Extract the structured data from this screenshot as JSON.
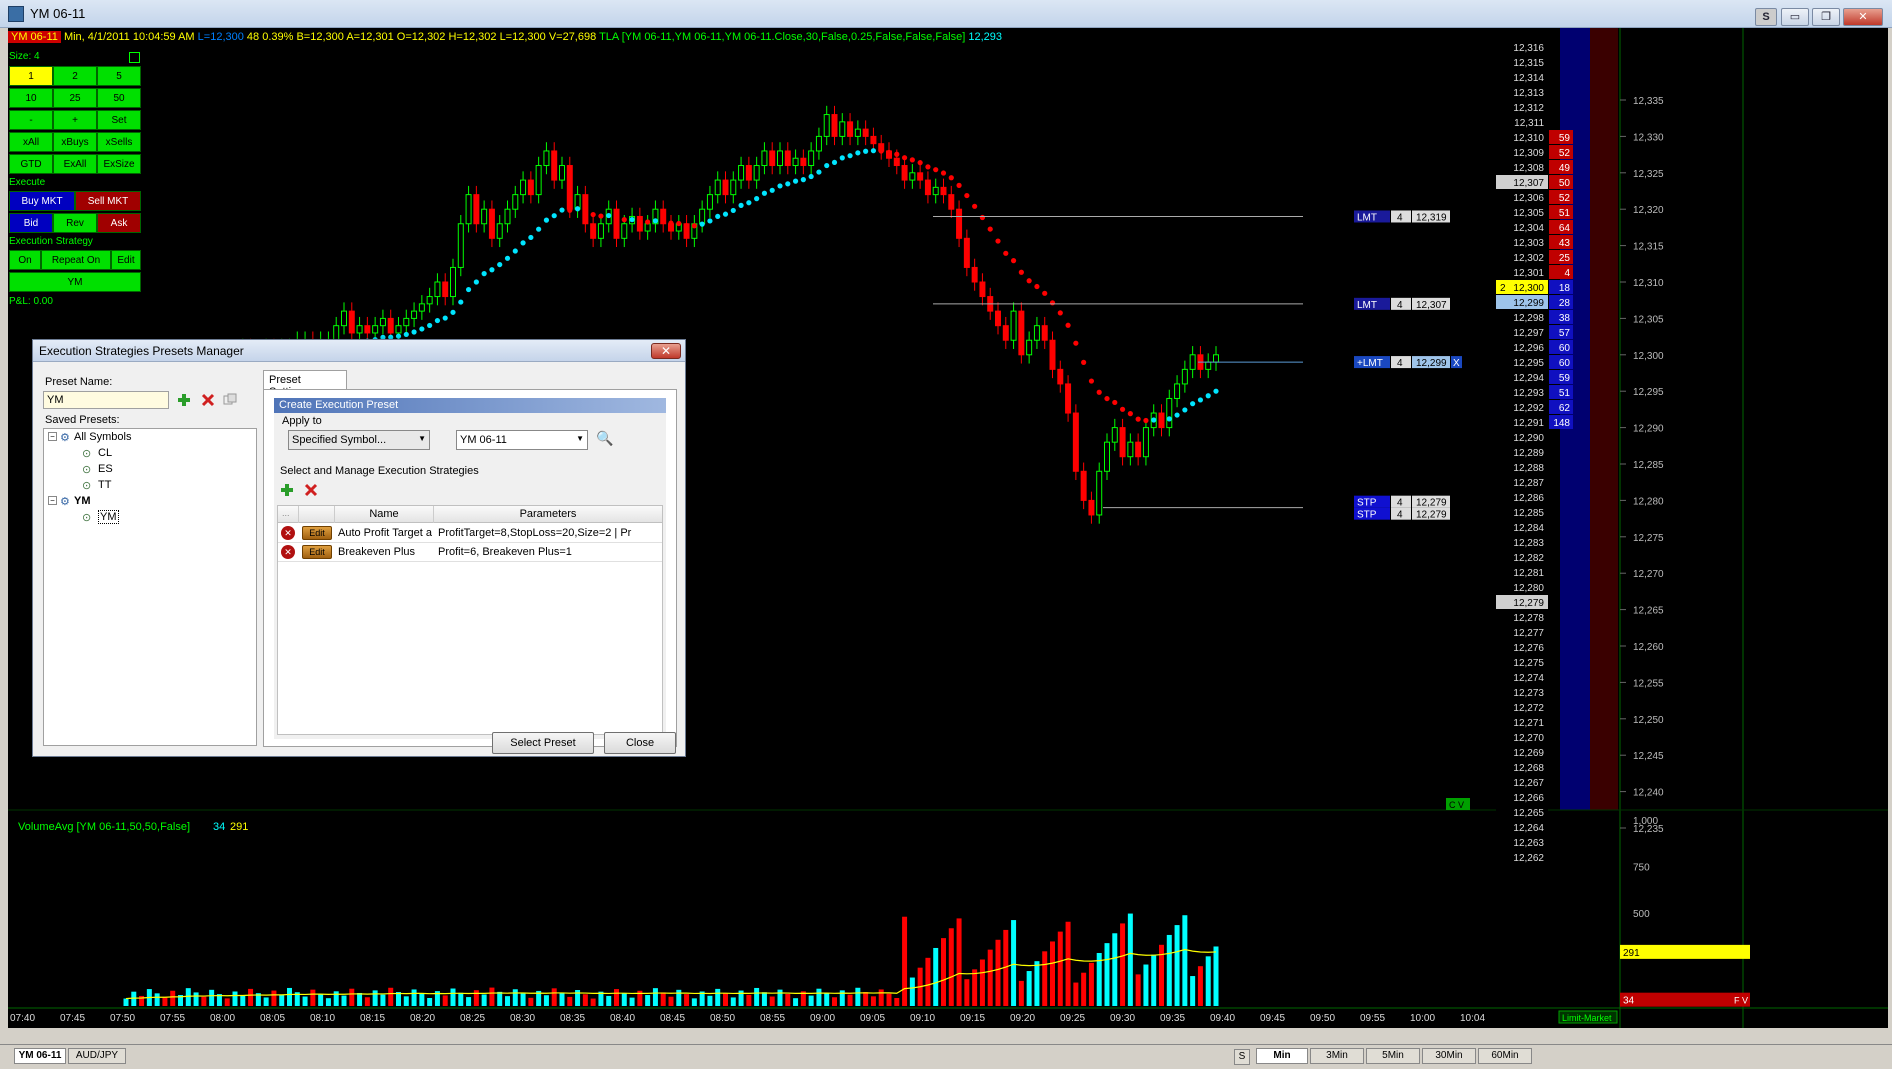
{
  "window": {
    "title": "YM 06-11",
    "buttons": [
      "S",
      "▭",
      "❐",
      "✕"
    ]
  },
  "infobar": {
    "symbol": "YM 06-11",
    "details": "Min, 4/1/2011  10:04:59 AM",
    "last": "L=12,300",
    "change": "48  0.39%",
    "bid": "B=12,300",
    "ask": "A=12,301",
    "open": "O=12,302",
    "high": "H=12,302",
    "low": "L=12,300",
    "volume": "V=27,698",
    "indicator": "TLA  [YM 06-11,YM 06-11,YM 06-11.Close,30,False,0.25,False,False,False]",
    "indicator_value": "12,293"
  },
  "control_panel": {
    "size_label": "Size: 4",
    "row1": [
      "1",
      "2",
      "5"
    ],
    "row2": [
      "10",
      "25",
      "50"
    ],
    "row3": [
      "-",
      "+",
      "Set"
    ],
    "row4": [
      "xAll",
      "xBuys",
      "xSells"
    ],
    "row5": [
      "GTD",
      "ExAll",
      "ExSize"
    ],
    "execute_label": "Execute",
    "buy_mkt": "Buy MKT",
    "sell_mkt": "Sell MKT",
    "bid": "Bid",
    "rev": "Rev",
    "ask": "Ask",
    "exec_strategy_label": "Execution Strategy",
    "on": "On",
    "repeat_on": "Repeat On",
    "edit": "Edit",
    "strategy_name": "YM",
    "pnl": "P&L: 0.00"
  },
  "dialog": {
    "title": "Execution Strategies Presets Manager",
    "preset_name_label": "Preset Name:",
    "preset_name_value": "YM",
    "saved_presets_label": "Saved Presets:",
    "tree": [
      {
        "label": "All Symbols",
        "children": [
          "CL",
          "ES",
          "TT"
        ]
      },
      {
        "label": "YM",
        "children": [
          "YM"
        ]
      }
    ],
    "tab": "Preset Settings",
    "section_header": "Create Execution Preset",
    "apply_to_label": "Apply to",
    "apply_to_value": "Specified Symbol...",
    "symbol_value": "YM 06-11",
    "manage_label": "Select and Manage Execution Strategies",
    "columns": [
      "...",
      "",
      "Name",
      "Parameters"
    ],
    "rows": [
      {
        "edit": "Edit",
        "name": "Auto Profit Target an",
        "params": "ProfitTarget=8,StopLoss=20,Size=2 | Pr"
      },
      {
        "edit": "Edit",
        "name": "Breakeven Plus",
        "params": "Profit=6, Breakeven Plus=1"
      }
    ],
    "select_button": "Select Preset",
    "close_button": "Close"
  },
  "price_axis": [
    "12,335",
    "12,330",
    "12,325",
    "12,320",
    "12,315",
    "12,310",
    "12,305",
    "12,300",
    "12,295",
    "12,290",
    "12,285",
    "12,280",
    "12,275",
    "12,270",
    "12,265",
    "12,260",
    "12,255",
    "12,250",
    "12,245",
    "12,240",
    "12,235"
  ],
  "orders": [
    {
      "type": "LMT",
      "qty": "4",
      "price": "12,319"
    },
    {
      "type": "LMT",
      "qty": "4",
      "price": "12,307"
    },
    {
      "type": "+LMT",
      "qty": "4",
      "price": "12,299",
      "x": "X"
    },
    {
      "type": "STP",
      "qty": "4",
      "price": "12,279"
    },
    {
      "type": "STP",
      "qty": "4",
      "price": "12,279"
    }
  ],
  "ladder": {
    "prices": [
      "12,316",
      "12,315",
      "12,314",
      "12,313",
      "12,312",
      "12,311",
      "12,310",
      "12,309",
      "12,308",
      "12,307",
      "12,306",
      "12,305",
      "12,304",
      "12,303",
      "12,302",
      "12,301",
      "12,300",
      "12,299",
      "12,298",
      "12,297",
      "12,296",
      "12,295",
      "12,294",
      "12,293",
      "12,292",
      "12,291",
      "12,290",
      "12,289",
      "12,288",
      "12,287",
      "12,286",
      "12,285",
      "12,284",
      "12,283",
      "12,282",
      "12,281",
      "12,280",
      "12,279",
      "12,278",
      "12,277",
      "12,276",
      "12,275",
      "12,274",
      "12,273",
      "12,272",
      "12,271",
      "12,270",
      "12,269",
      "12,268",
      "12,267",
      "12,266",
      "12,265",
      "12,264",
      "12,263",
      "12,262"
    ],
    "ask_sizes": [
      "",
      "",
      "",
      "",
      "",
      "",
      "59",
      "52",
      "49",
      "50",
      "52",
      "51",
      "64",
      "43",
      "25",
      "4"
    ],
    "bid_sizes": [
      "18",
      "28",
      "38",
      "57",
      "60",
      "60",
      "59",
      "51",
      "62",
      "148"
    ],
    "last_marker": "2",
    "cv": "C V"
  },
  "volume_panel": {
    "label": "VolumeAvg  [YM 06-11,50,50,False]",
    "val1": "34",
    "val2": "291",
    "axis": [
      "1,000",
      "750",
      "500"
    ],
    "avg_badge": "291",
    "vol_badge": "34",
    "fv": "F V"
  },
  "time_axis": [
    "07:40",
    "07:45",
    "07:50",
    "07:55",
    "08:00",
    "08:05",
    "08:10",
    "08:15",
    "08:20",
    "08:25",
    "08:30",
    "08:35",
    "08:40",
    "08:45",
    "08:50",
    "08:55",
    "09:00",
    "09:05",
    "09:10",
    "09:15",
    "09:20",
    "09:25",
    "09:30",
    "09:35",
    "09:40",
    "09:45",
    "09:50",
    "09:55",
    "10:00",
    "10:04"
  ],
  "order_type_badge": "Limit-Market",
  "bottom_tabs": [
    "YM 06-11",
    "AUD/JPY"
  ],
  "interval_tabs": [
    "S",
    "Min",
    "3Min",
    "5Min",
    "30Min",
    "60Min"
  ],
  "colors": {
    "up": "#00ff00",
    "down": "#ff0000",
    "tla_up": "#00e5ff",
    "tla_down": "#ff0000",
    "vol_up": "#00ffff",
    "vol_down": "#ff0000",
    "avg": "#ffff00"
  }
}
